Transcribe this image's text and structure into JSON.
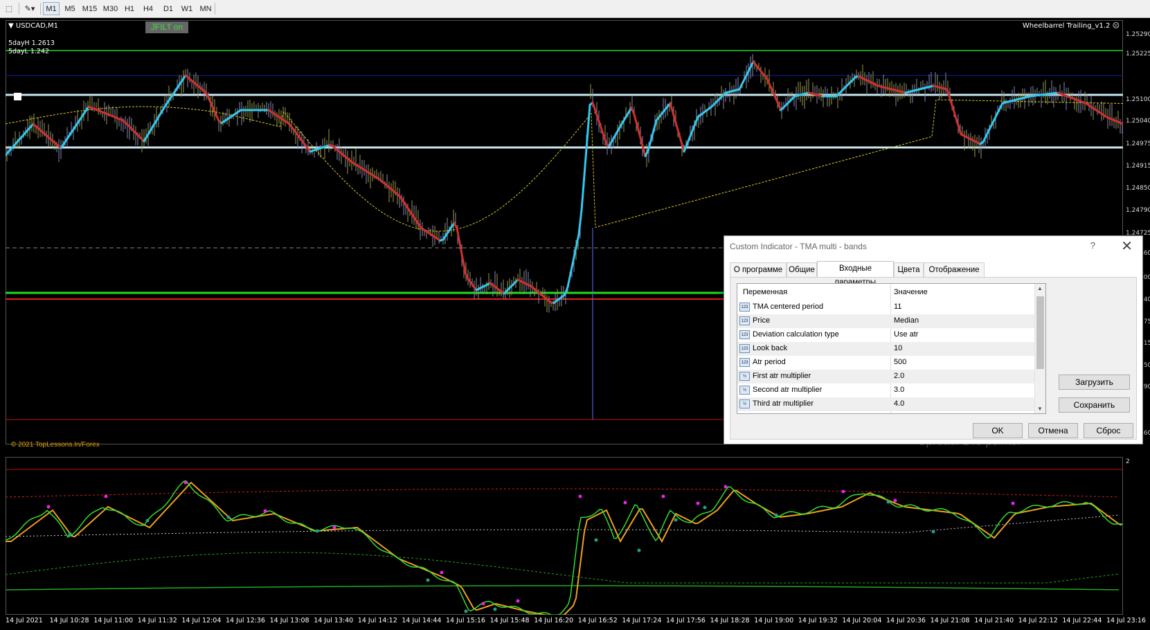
{
  "toolbar": {
    "timeframes": [
      "M1",
      "M5",
      "M15",
      "M30",
      "H1",
      "H4",
      "D1",
      "W1",
      "MN"
    ],
    "active": "M1"
  },
  "chart": {
    "symbol": "USDCAD,M1",
    "jfilt": "JFILT on",
    "day_high": "5dayH 1.2613",
    "day_low": "5dayL 1.242",
    "ea_title": "Wheelbarrel Trailing_v1.2",
    "copyright": "© 2021 TopLessons.In/Forex",
    "spread": "Spread: 149 points.",
    "price_ticks": [
      "1.25290",
      "1.25225",
      "1.25100",
      "1.25040",
      "1.24975",
      "1.24915",
      "1.24850",
      "1.24790",
      "1.24725",
      "1.24660",
      "1.24600",
      "1.24540",
      "1.24475",
      "1.24415",
      "1.24350",
      "1.24290",
      "1.24160"
    ],
    "sub_scale_top": "2",
    "time_ticks": [
      "14 Jul 2021",
      "14 Jul 10:28",
      "14 Jul 11:00",
      "14 Jul 11:32",
      "14 Jul 12:04",
      "14 Jul 12:36",
      "14 Jul 13:08",
      "14 Jul 13:40",
      "14 Jul 14:12",
      "14 Jul 14:44",
      "14 Jul 15:16",
      "14 Jul 15:48",
      "14 Jul 16:20",
      "14 Jul 16:52",
      "14 Jul 17:24",
      "14 Jul 17:56",
      "14 Jul 18:28",
      "14 Jul 19:00",
      "14 Jul 19:32",
      "14 Jul 20:04",
      "14 Jul 20:36",
      "14 Jul 21:08",
      "14 Jul 21:40",
      "14 Jul 22:12",
      "14 Jul 22:44",
      "14 Jul 23:16"
    ],
    "colors": {
      "up": "#33c8f0",
      "down": "#d03030",
      "avg": "#e0d020",
      "support": "#20e020",
      "resist": "#e02020",
      "band": "#c8e8f0"
    }
  },
  "dialog": {
    "title": "Custom Indicator - TMA multi - bands",
    "help": "?",
    "close": "✕",
    "tabs": [
      "О программе",
      "Общие",
      "Входные параметры",
      "Цвета",
      "Отображение"
    ],
    "selected_tab": "Входные параметры",
    "col_variable": "Переменная",
    "col_value": "Значение",
    "params": [
      {
        "icon": "123",
        "name": "TMA centered period",
        "value": "11"
      },
      {
        "icon": "123",
        "name": "Price",
        "value": "Median"
      },
      {
        "icon": "123",
        "name": "Deviation calculation type",
        "value": "Use atr"
      },
      {
        "icon": "123",
        "name": "Look back",
        "value": "10"
      },
      {
        "icon": "123",
        "name": "Atr period",
        "value": "500"
      },
      {
        "icon": "½",
        "name": "First atr multiplier",
        "value": "2.0"
      },
      {
        "icon": "½",
        "name": "Second atr multiplier",
        "value": "3.0"
      },
      {
        "icon": "½",
        "name": "Third atr multiplier",
        "value": "4.0"
      }
    ],
    "load": "Загрузить",
    "save": "Сохранить",
    "ok": "OK",
    "cancel": "Отмена",
    "reset": "Сброс"
  }
}
